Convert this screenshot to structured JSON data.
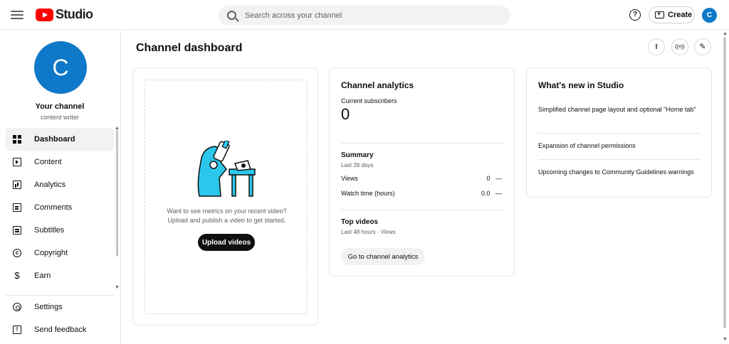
{
  "topbar": {
    "logo_text": "Studio",
    "search_placeholder": "Search across your channel",
    "help_label": "?",
    "create_label": "Create",
    "avatar_letter": "C"
  },
  "sidebar": {
    "channel_avatar_letter": "C",
    "channel_name": "Your channel",
    "channel_subtitle": "content writer",
    "items": [
      {
        "label": "Dashboard",
        "icon": "dashboard-icon",
        "active": true
      },
      {
        "label": "Content",
        "icon": "content-icon"
      },
      {
        "label": "Analytics",
        "icon": "analytics-icon"
      },
      {
        "label": "Comments",
        "icon": "comments-icon"
      },
      {
        "label": "Subtitles",
        "icon": "subtitles-icon"
      },
      {
        "label": "Copyright",
        "icon": "copyright-icon"
      },
      {
        "label": "Earn",
        "icon": "earn-icon"
      }
    ],
    "bottom_items": [
      {
        "label": "Settings",
        "icon": "gear-icon"
      },
      {
        "label": "Send feedback",
        "icon": "feedback-icon"
      }
    ]
  },
  "main": {
    "title": "Channel dashboard",
    "actions": [
      {
        "icon": "upload-icon",
        "glyph": "⭱"
      },
      {
        "icon": "live-icon",
        "glyph": "((•))"
      },
      {
        "icon": "edit-icon",
        "glyph": "✎"
      }
    ]
  },
  "upload_card": {
    "message_line1": "Want to see metrics on your recent video?",
    "message_line2": "Upload and publish a video to get started.",
    "button_label": "Upload videos"
  },
  "analytics_card": {
    "title": "Channel analytics",
    "subscribers_label": "Current subscribers",
    "subscribers_value": "0",
    "summary_title": "Summary",
    "summary_period": "Last 28 days",
    "rows": [
      {
        "label": "Views",
        "value": "0",
        "trend": "—"
      },
      {
        "label": "Watch time (hours)",
        "value": "0.0",
        "trend": "—"
      }
    ],
    "top_videos_title": "Top videos",
    "top_videos_period": "Last 48 hours · Views",
    "button_label": "Go to channel analytics"
  },
  "news_card": {
    "title": "What's new in Studio",
    "items": [
      "Simplified channel page layout and optional \"Home tab\"",
      "Expansion of channel permissions",
      "Upcoming changes to Community Guidelines warnings"
    ]
  },
  "colors": {
    "brand_red": "#ff0000",
    "avatar_blue": "#0e79c8",
    "illustration_cyan": "#2cc8ec"
  }
}
